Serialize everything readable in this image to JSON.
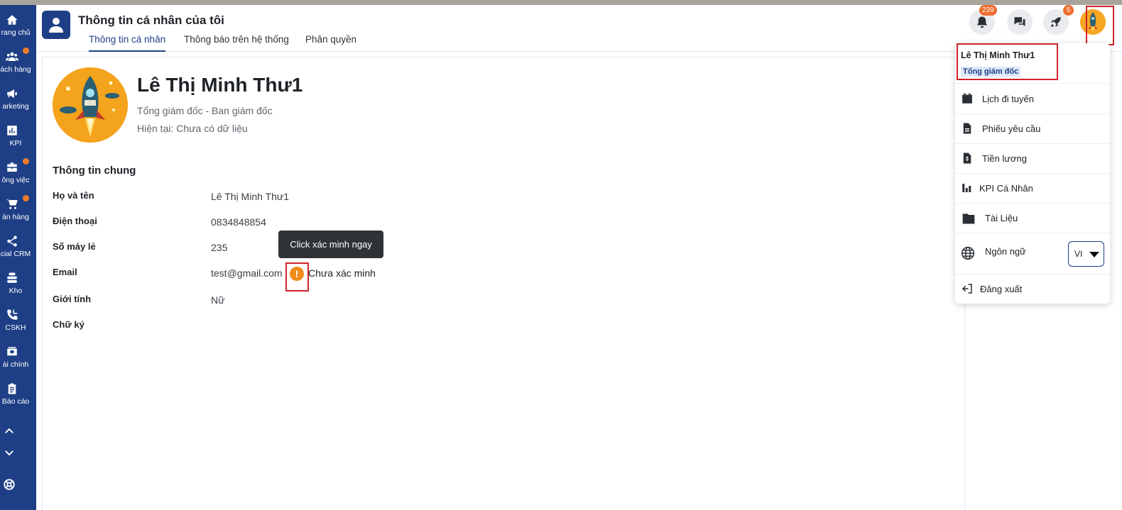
{
  "sidebar": {
    "items": [
      {
        "label": "rang chủ",
        "icon": "home-icon",
        "dot": false
      },
      {
        "label": "ách hàng",
        "icon": "customers-icon",
        "dot": true
      },
      {
        "label": "arketing",
        "icon": "megaphone-icon",
        "dot": false
      },
      {
        "label": "KPI",
        "icon": "chart-icon",
        "dot": false
      },
      {
        "label": "ông việc",
        "icon": "briefcase-icon",
        "dot": true
      },
      {
        "label": "án hàng",
        "icon": "cart-icon",
        "dot": true
      },
      {
        "label": "cial CRM",
        "icon": "share-icon",
        "dot": false
      },
      {
        "label": "Kho",
        "icon": "warehouse-icon",
        "dot": false
      },
      {
        "label": "CSKH",
        "icon": "phone-icon",
        "dot": false
      },
      {
        "label": "ài chính",
        "icon": "finance-icon",
        "dot": false
      },
      {
        "label": "Báo cáo",
        "icon": "clipboard-icon",
        "dot": false
      }
    ]
  },
  "header": {
    "title": "Thông tin cá nhân của tôi",
    "tabs": [
      {
        "label": "Thông tin cá nhân",
        "active": true
      },
      {
        "label": "Thông báo trên hệ thống",
        "active": false
      },
      {
        "label": "Phân quyền",
        "active": false
      }
    ],
    "notification_count": "239",
    "rocket_count": "5"
  },
  "profile": {
    "name": "Lê Thị Minh Thư1",
    "role": "Tổng giám đốc - Ban giám đốc",
    "current": "Hiện tại: Chưa có dữ liệu"
  },
  "general": {
    "title": "Thông tin chung",
    "fields": [
      {
        "label": "Họ và tên",
        "value": "Lê Thị Minh Thư1"
      },
      {
        "label": "Điện thoại",
        "value": "0834848854"
      },
      {
        "label": "Số máy lẻ",
        "value": "235"
      },
      {
        "label": "Email",
        "value": "test@gmail.com"
      },
      {
        "label": "Giới tính",
        "value": "Nữ"
      },
      {
        "label": "Chữ ký",
        "value": ""
      }
    ],
    "email_status": "Chưa xác minh",
    "tooltip": "Click xác minh ngay"
  },
  "dropdown": {
    "user_name": "Lê Thị Minh Thư1",
    "user_role": "Tổng giám đốc",
    "items": [
      {
        "label": "Lịch đi tuyến",
        "icon": "calendar-icon"
      },
      {
        "label": "Phiếu yêu cầu",
        "icon": "document-icon"
      },
      {
        "label": "Tiền lương",
        "icon": "salary-icon"
      },
      {
        "label": "KPI Cá Nhân",
        "icon": "kpi-icon"
      },
      {
        "label": "Tài Liệu",
        "icon": "folder-icon"
      },
      {
        "label": "Ngôn ngữ",
        "icon": "globe-icon"
      },
      {
        "label": "Đăng xuất",
        "icon": "logout-icon"
      }
    ],
    "language_value": "VI"
  },
  "colors": {
    "brand": "#1e3f86",
    "badge": "#ef6c2f",
    "warning": "#ef8c1b",
    "highlight_border": "#d2232a"
  }
}
